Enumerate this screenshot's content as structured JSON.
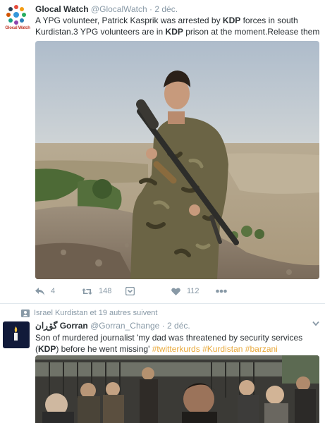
{
  "tweet1": {
    "brand": "Glocal Watch",
    "name": "Glocal Watch",
    "handle": "@GlocalWatch",
    "dot": "·",
    "time": "2 déc.",
    "text_parts": {
      "p1": "A YPG volunteer, Patrick Kasprik was arrested by ",
      "kdp1": "KDP",
      "p2": " forces in south Kurdistan.3 YPG volunteers are in ",
      "kdp2": "KDP",
      "p3": " prison at the moment.Release them"
    },
    "actions": {
      "reply_count": "4",
      "retweet_count": "148",
      "like_count": "112"
    }
  },
  "tweet2": {
    "context": "Israel Kurdistan et 19 autres suivent",
    "name": "گۆڕان Gorran",
    "handle": "@Gorran_Change",
    "dot": "·",
    "time": "2 déc.",
    "text_parts": {
      "p1": "Son of murdered journalist 'my dad was threatened by security services (",
      "kdp": "KDP",
      "p2": ") before he went missing' ",
      "h1": "#twitterkurds",
      "h2": "#Kurdistan",
      "h3": "#barzani"
    }
  },
  "colors": {
    "hashtag": "#e8a83a",
    "muted": "#8899a6",
    "text": "#292f33"
  }
}
